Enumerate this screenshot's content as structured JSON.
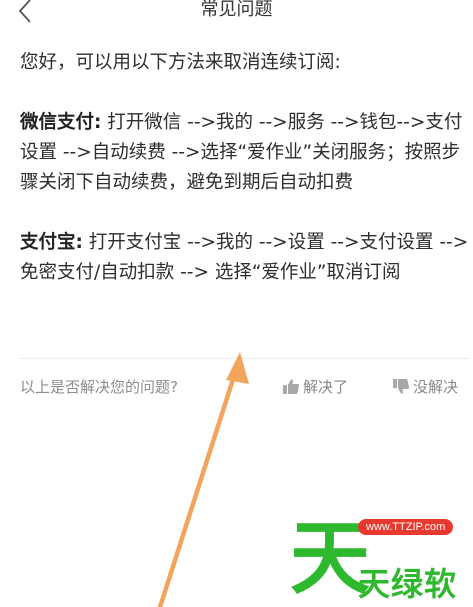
{
  "header": {
    "title": "常见问题",
    "back_icon": "chevron-left-icon"
  },
  "content": {
    "intro": "您好，可以用以下方法来取消连续订阅:",
    "wechat": {
      "label": "微信支付:",
      "text": " 打开微信 -->我的 -->服务 -->钱包-->支付设置 -->自动续费 -->选择“爱作业”关闭服务；按照步骤关闭下自动续费，避免到期后自动扣费"
    },
    "alipay": {
      "label": "支付宝:",
      "text": " 打开支付宝 -->我的 -->设置 -->支付设置 -->免密支付/自动扣款 --> 选择“爱作业”取消订阅"
    }
  },
  "footer": {
    "question": "以上是否解决您的问题?",
    "solved_label": "解决了",
    "unsolved_label": "没解决",
    "solved_icon": "thumbs-up-icon",
    "unsolved_icon": "thumbs-down-icon"
  },
  "watermark": {
    "big_char": "天",
    "url": "www.TTZIP.com",
    "brand": "天绿软"
  },
  "colors": {
    "arrow": "#f0a05a",
    "watermark_green": "#2db82d",
    "watermark_red": "#e8392f",
    "muted": "#8d8d8d"
  }
}
